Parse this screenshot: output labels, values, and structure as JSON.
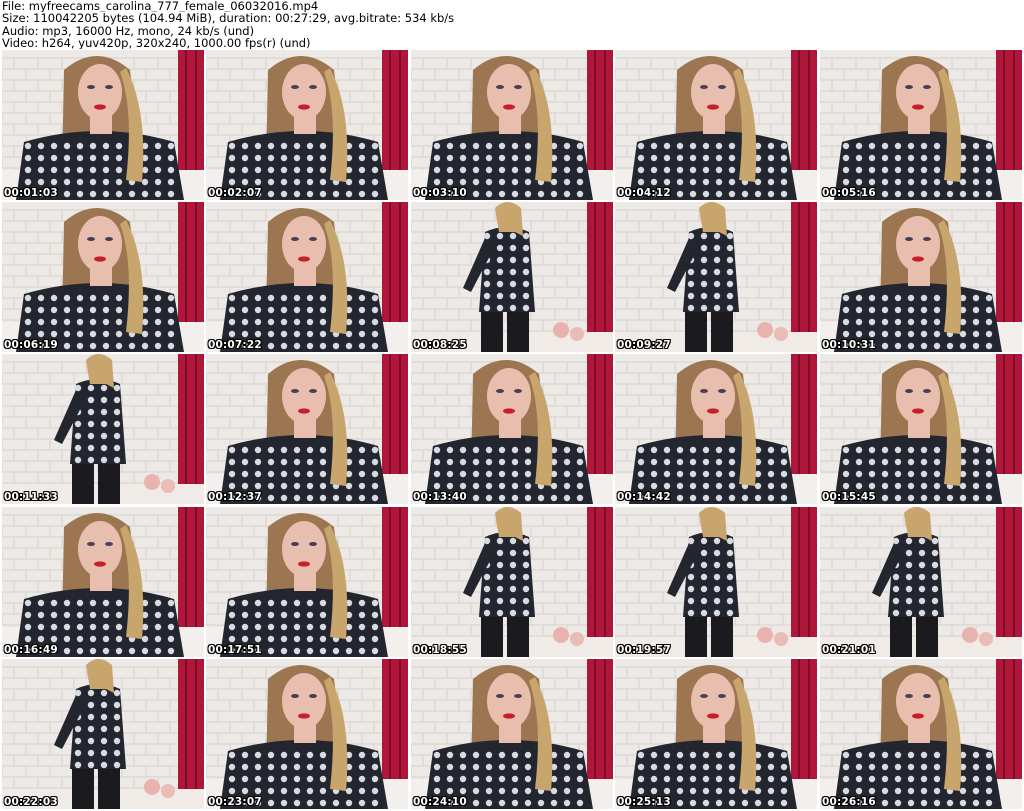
{
  "header": {
    "file": "File: myfreecams_carolina_777_female_06032016.mp4",
    "size": "Size: 110042205 bytes (104.94 MiB), duration: 00:27:29, avg.bitrate: 534 kb/s",
    "audio": "Audio: mp3, 16000 Hz, mono, 24 kb/s (und)",
    "video": "Video: h264, yuv420p, 320x240, 1000.00 fps(r) (und)"
  },
  "colors": {
    "wall": "#ece9e6",
    "curtain": "#b0153a",
    "skin": "#e8bfae",
    "hair": "#9b7650",
    "top": "#23262f",
    "lips": "#c81e2c"
  },
  "thumbnails": [
    {
      "timestamp": "00:01:03",
      "pose": "close"
    },
    {
      "timestamp": "00:02:07",
      "pose": "close"
    },
    {
      "timestamp": "00:03:10",
      "pose": "close"
    },
    {
      "timestamp": "00:04:12",
      "pose": "close"
    },
    {
      "timestamp": "00:05:16",
      "pose": "close"
    },
    {
      "timestamp": "00:06:19",
      "pose": "close"
    },
    {
      "timestamp": "00:07:22",
      "pose": "close"
    },
    {
      "timestamp": "00:08:25",
      "pose": "standing"
    },
    {
      "timestamp": "00:09:27",
      "pose": "standing"
    },
    {
      "timestamp": "00:10:31",
      "pose": "close"
    },
    {
      "timestamp": "00:11:33",
      "pose": "standing"
    },
    {
      "timestamp": "00:12:37",
      "pose": "close"
    },
    {
      "timestamp": "00:13:40",
      "pose": "close"
    },
    {
      "timestamp": "00:14:42",
      "pose": "close"
    },
    {
      "timestamp": "00:15:45",
      "pose": "close"
    },
    {
      "timestamp": "00:16:49",
      "pose": "close"
    },
    {
      "timestamp": "00:17:51",
      "pose": "close"
    },
    {
      "timestamp": "00:18:55",
      "pose": "standing"
    },
    {
      "timestamp": "00:19:57",
      "pose": "standing"
    },
    {
      "timestamp": "00:21:01",
      "pose": "standing"
    },
    {
      "timestamp": "00:22:03",
      "pose": "standing"
    },
    {
      "timestamp": "00:23:07",
      "pose": "close"
    },
    {
      "timestamp": "00:24:10",
      "pose": "close"
    },
    {
      "timestamp": "00:25:13",
      "pose": "close"
    },
    {
      "timestamp": "00:26:16",
      "pose": "close"
    }
  ]
}
